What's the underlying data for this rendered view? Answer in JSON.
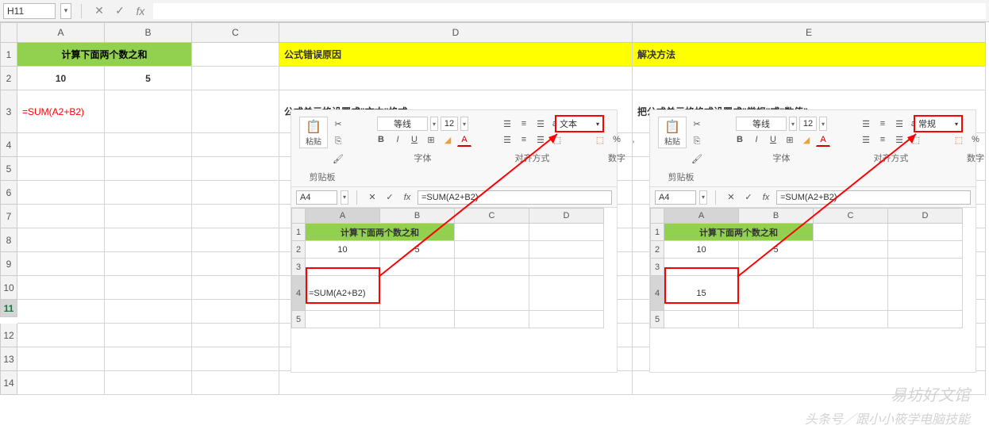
{
  "formula_bar": {
    "name_box": "H11",
    "cancel": "✕",
    "confirm": "✓",
    "fx": "fx"
  },
  "columns": [
    "A",
    "B",
    "C",
    "D",
    "E"
  ],
  "rows": [
    "1",
    "2",
    "3",
    "4",
    "5",
    "6",
    "7",
    "8",
    "9",
    "10",
    "11",
    "12",
    "13",
    "14"
  ],
  "main": {
    "header_ab": "计算下面两个数之和",
    "header_d": "公式错误原因",
    "header_e": "解决方法",
    "val_a2": "10",
    "val_b2": "5",
    "val_a3": "=SUM(A2+B2)",
    "desc_d": "公式单元格设置成\"文本\"格式",
    "desc_e": "把公式单元格格式设置成\"常规\"或\"数值\""
  },
  "embed_common": {
    "paste_label": "粘贴",
    "clip_grp": "剪贴板",
    "font_name": "等线",
    "font_size": "12",
    "font_grp": "字体",
    "align_grp": "对齐方式",
    "num_grp": "数字",
    "name_box": "A4",
    "fx": "fx",
    "formula": "=SUM(A2+B2)",
    "cols": [
      "A",
      "B",
      "C",
      "D"
    ],
    "rows": [
      "1",
      "2",
      "3",
      "4",
      "5"
    ],
    "header": "计算下面两个数之和",
    "val_a2": "10",
    "val_b2": "5"
  },
  "embed1": {
    "fmt": "文本",
    "val_a4": "=SUM(A2+B2)"
  },
  "embed2": {
    "fmt": "常规",
    "val_a4": "15"
  },
  "icons": {
    "cut": "✂",
    "copy": "⎘",
    "brush": "🖌",
    "bold": "B",
    "italic": "I",
    "underline": "U",
    "border": "⊞",
    "fill": "◢",
    "fontcolor": "A",
    "align_l": "☰",
    "align_c": "≡",
    "align_r": "☰",
    "wrap": "ab",
    "merge": "⬚",
    "indent_l": "≪",
    "indent_r": "≫",
    "pct": "%",
    "comma": ",",
    "num_ico": "⬚",
    "drop": "▾"
  },
  "watermarks": {
    "w1": "易坊好文馆",
    "w2": "头条号／跟小小筱学电脑技能"
  }
}
